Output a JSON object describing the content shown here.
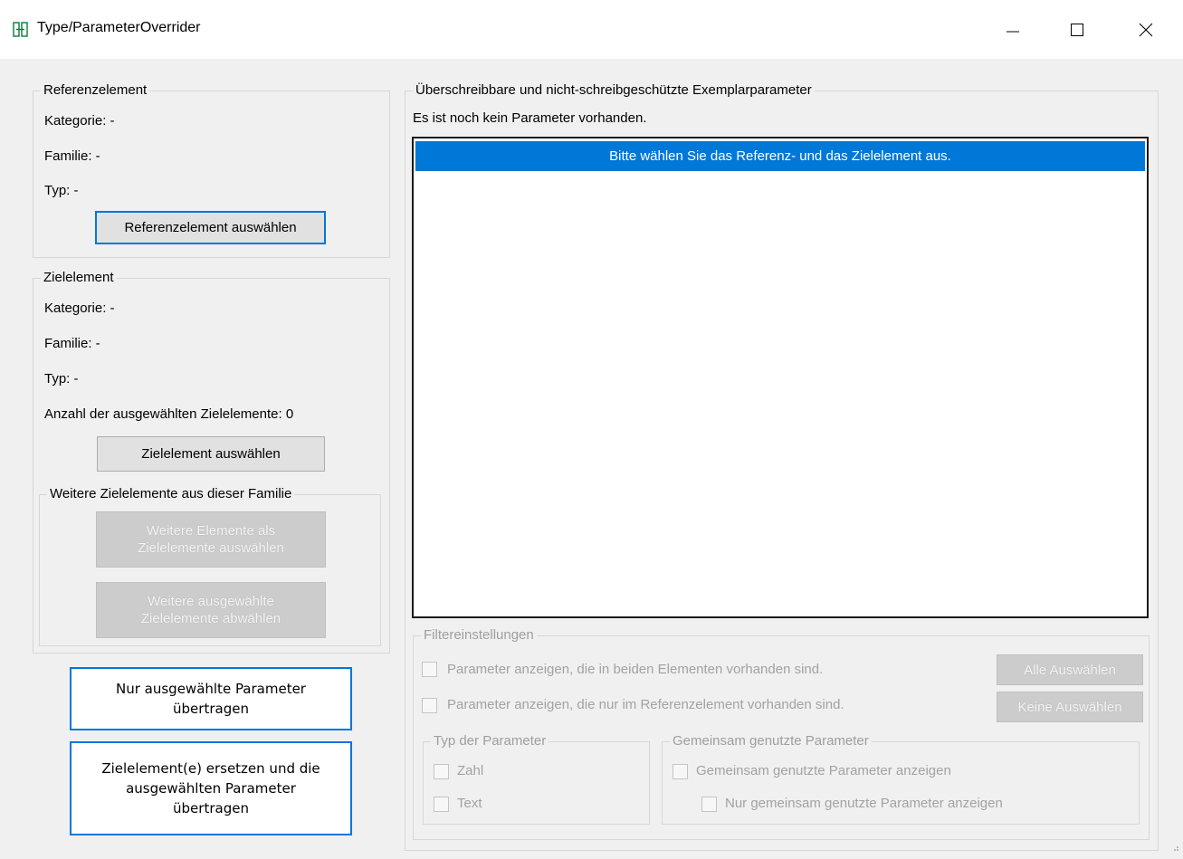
{
  "window": {
    "title": "Type/ParameterOverrider",
    "icon": "split-window-icon"
  },
  "reference": {
    "legend": "Referenzelement",
    "kategorie": "Kategorie: -",
    "familie": "Familie: -",
    "typ": "Typ: -",
    "select_button": "Referenzelement auswählen"
  },
  "target": {
    "legend": "Zielelement",
    "kategorie": "Kategorie: -",
    "familie": "Familie: -",
    "typ": "Typ: -",
    "count": "Anzahl der ausgewählten Zielelemente: 0",
    "select_button": "Zielelement auswählen",
    "more": {
      "legend": "Weitere Zielelemente aus dieser Familie",
      "select_more_line1": "Weitere Elemente als",
      "select_more_line2": "Zielelemente auswählen",
      "deselect_line1": "Weitere ausgewählte",
      "deselect_line2": "Zielelemente abwählen"
    }
  },
  "actions": {
    "transfer_line1": "Nur ausgewählte Parameter",
    "transfer_line2": "übertragen",
    "replace_line1": "Zielelement(e) ersetzen und die",
    "replace_line2": "ausgewählten Parameter",
    "replace_line3": "übertragen"
  },
  "parameters": {
    "legend": "Überschreibbare und nicht-schreibgeschützte Exemplarparameter",
    "status": "Es ist noch kein Parameter vorhanden.",
    "list_message": "Bitte wählen Sie das Referenz- und das Zielelement aus."
  },
  "filter": {
    "legend": "Filtereinstellungen",
    "show_both": "Parameter anzeigen, die in beiden Elementen vorhanden sind.",
    "show_ref_only": "Parameter anzeigen, die nur im Referenzelement vorhanden sind.",
    "select_all": "Alle Auswählen",
    "select_none": "Keine Auswählen",
    "type_group": {
      "legend": "Typ der Parameter",
      "number": "Zahl",
      "text": "Text"
    },
    "shared_group": {
      "legend": "Gemeinsam genutzte Parameter",
      "show_shared": "Gemeinsam genutzte Parameter anzeigen",
      "only_shared": "Nur gemeinsam genutzte Parameter anzeigen"
    }
  },
  "colors": {
    "accent": "#0078d7",
    "background": "#f0f0f0"
  }
}
